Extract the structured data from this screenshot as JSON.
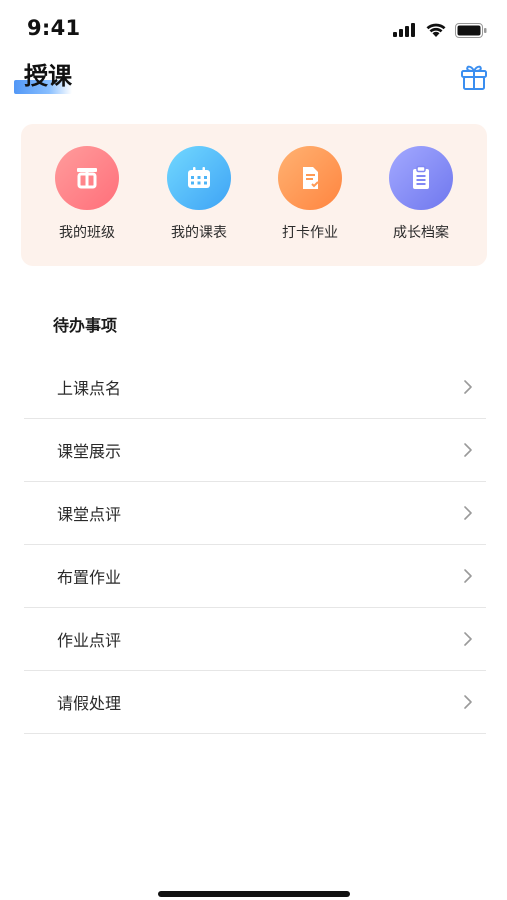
{
  "status_bar": {
    "time": "9:41"
  },
  "header": {
    "title": "授课",
    "gift_icon": "gift-icon"
  },
  "quick_actions": [
    {
      "label": "我的班级",
      "icon": "class-icon",
      "color_from": "#ff8e8e",
      "color_to": "#ff6f7a"
    },
    {
      "label": "我的课表",
      "icon": "calendar-icon",
      "color_from": "#6fd3ff",
      "color_to": "#3ea3f5"
    },
    {
      "label": "打卡作业",
      "icon": "document-check-icon",
      "color_from": "#ffae6b",
      "color_to": "#ff8540"
    },
    {
      "label": "成长档案",
      "icon": "clipboard-icon",
      "color_from": "#9ea4ff",
      "color_to": "#6f77ee"
    }
  ],
  "todo": {
    "title": "待办事项",
    "items": [
      {
        "label": "上课点名"
      },
      {
        "label": "课堂展示"
      },
      {
        "label": "课堂点评"
      },
      {
        "label": "布置作业"
      },
      {
        "label": "作业点评"
      },
      {
        "label": "请假处理"
      }
    ]
  },
  "colors": {
    "card_bg": "#fdf2ec",
    "accent_blue": "#3f8cf5",
    "divider": "#e6e6e6"
  }
}
